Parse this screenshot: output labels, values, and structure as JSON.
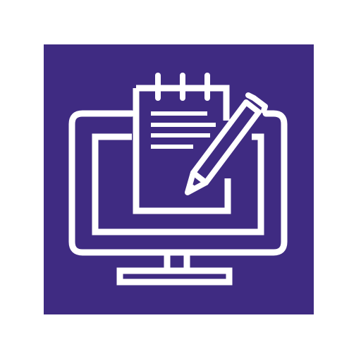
{
  "icon": {
    "name": "computer-notepad-pen",
    "background_color": "#3f2b82",
    "glyph_color": "#ffffff",
    "page_background": "#ffffff"
  }
}
